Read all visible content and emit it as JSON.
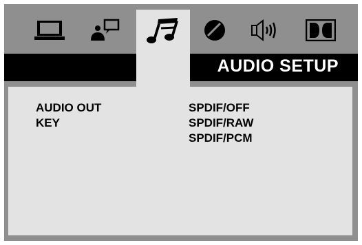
{
  "tabs": [
    {
      "icon": "monitor-icon",
      "active": false
    },
    {
      "icon": "speaker-person-icon",
      "active": false
    },
    {
      "icon": "music-note-icon",
      "active": true
    },
    {
      "icon": "contrast-icon",
      "active": false
    },
    {
      "icon": "volume-icon",
      "active": false
    },
    {
      "icon": "dolby-icon",
      "active": false
    }
  ],
  "header": {
    "title": "AUDIO SETUP"
  },
  "menu": {
    "items": [
      "AUDIO OUT",
      "KEY"
    ],
    "options": [
      "SPDIF/OFF",
      "SPDIF/RAW",
      "SPDIF/PCM"
    ]
  },
  "colors": {
    "frame": "#8f8f8f",
    "panel": "#e3e3e3",
    "titlebar": "#000000",
    "title_text": "#ffffff"
  }
}
